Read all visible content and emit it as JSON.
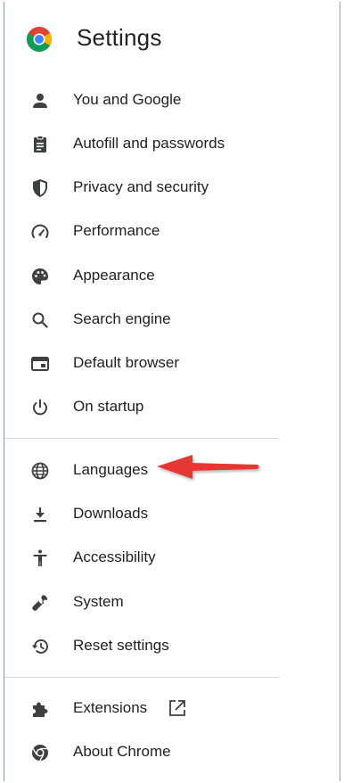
{
  "header": {
    "title": "Settings",
    "logo_icon": "chrome-logo-icon"
  },
  "colors": {
    "icon": "#3c4043",
    "text": "#202124",
    "divider": "#dadce0",
    "annotation_arrow": "#e53935"
  },
  "sidebar": {
    "items": [
      {
        "label": "You and Google",
        "icon": "person-icon"
      },
      {
        "label": "Autofill and passwords",
        "icon": "clipboard-icon"
      },
      {
        "label": "Privacy and security",
        "icon": "shield-icon"
      },
      {
        "label": "Performance",
        "icon": "speedometer-icon"
      },
      {
        "label": "Appearance",
        "icon": "palette-icon"
      },
      {
        "label": "Search engine",
        "icon": "search-icon"
      },
      {
        "label": "Default browser",
        "icon": "browser-window-icon"
      },
      {
        "label": "On startup",
        "icon": "power-icon"
      },
      {
        "label": "Languages",
        "icon": "globe-icon"
      },
      {
        "label": "Downloads",
        "icon": "download-icon"
      },
      {
        "label": "Accessibility",
        "icon": "accessibility-icon"
      },
      {
        "label": "System",
        "icon": "wrench-icon"
      },
      {
        "label": "Reset settings",
        "icon": "reset-history-icon"
      },
      {
        "label": "Extensions",
        "icon": "puzzle-icon",
        "trailing_icon": "open-in-new-icon"
      },
      {
        "label": "About Chrome",
        "icon": "chrome-icon"
      }
    ]
  },
  "annotation": {
    "type": "arrow",
    "points_to": "Languages"
  }
}
